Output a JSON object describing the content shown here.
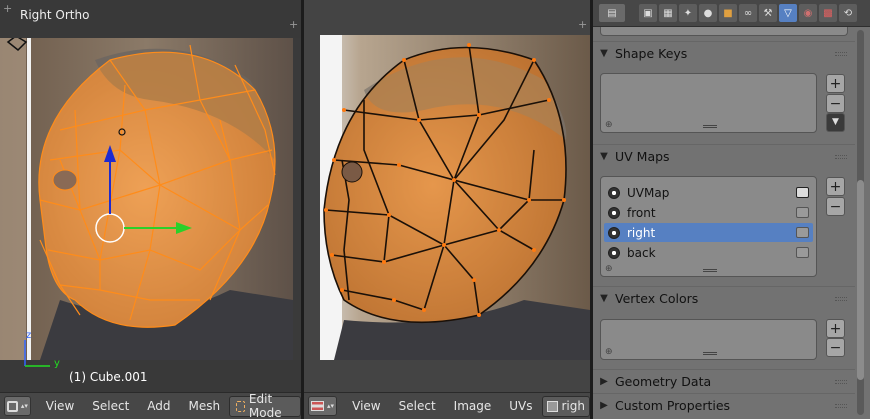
{
  "viewport3d": {
    "title": "Right Ortho",
    "object_label": "(1) Cube.001",
    "axis_z": "z",
    "axis_y": "y",
    "header": {
      "menus": [
        "View",
        "Select",
        "Add",
        "Mesh"
      ],
      "mode": "Edit Mode"
    }
  },
  "uv_editor": {
    "header": {
      "menus": [
        "View",
        "Select",
        "Image",
        "UVs"
      ],
      "uv_map_field": "righ"
    }
  },
  "properties": {
    "tabs": [
      "render-icon",
      "render-layers-icon",
      "scene-icon",
      "world-icon",
      "object-icon",
      "constraints-icon",
      "modifiers-icon",
      "data-icon",
      "material-icon",
      "texture-icon"
    ],
    "active_tab": "data-icon",
    "sections": {
      "shape_keys": "Shape Keys",
      "uv_maps": "UV Maps",
      "vertex_colors": "Vertex Colors",
      "geometry_data": "Geometry Data",
      "custom_properties": "Custom Properties"
    },
    "uv_maps": [
      {
        "name": "UVMap",
        "selected": false,
        "active_render": true
      },
      {
        "name": "front",
        "selected": false,
        "active_render": false
      },
      {
        "name": "right",
        "selected": true,
        "active_render": false
      },
      {
        "name": "back",
        "selected": false,
        "active_render": false
      }
    ]
  },
  "colors": {
    "mesh_edge": "#ff8c1a",
    "uv_edge": "#1a1008",
    "selection": "#5680c2"
  }
}
